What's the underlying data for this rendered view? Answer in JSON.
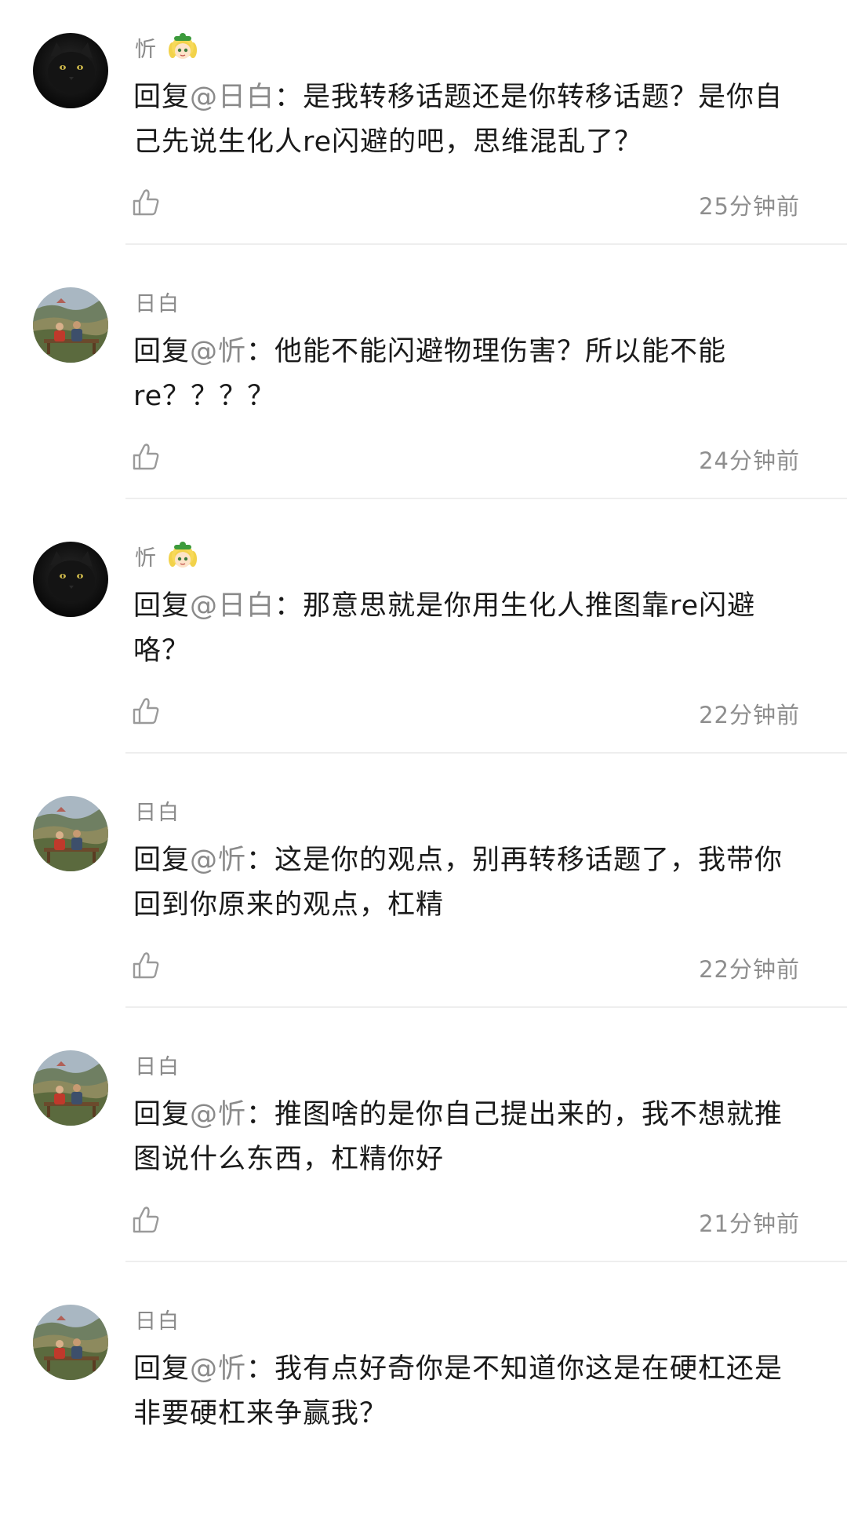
{
  "comments": [
    {
      "username": "忻",
      "has_badge": true,
      "avatar": "black-cat-avatar",
      "reply_prefix": "回复",
      "mention": "@日白",
      "text": "：是我转移话题还是你转移话题？是你自己先说生化人re闪避的吧，思维混乱了？",
      "time": "25分钟前"
    },
    {
      "username": "日白",
      "has_badge": false,
      "avatar": "landscape-couple-avatar",
      "reply_prefix": "回复",
      "mention": "@忻",
      "text": "：他能不能闪避物理伤害？所以能不能re？？？？",
      "time": "24分钟前"
    },
    {
      "username": "忻",
      "has_badge": true,
      "avatar": "black-cat-avatar",
      "reply_prefix": "回复",
      "mention": "@日白",
      "text": "：那意思就是你用生化人推图靠re闪避咯？",
      "time": "22分钟前"
    },
    {
      "username": "日白",
      "has_badge": false,
      "avatar": "landscape-couple-avatar",
      "reply_prefix": "回复",
      "mention": "@忻",
      "text": "：这是你的观点，别再转移话题了，我带你回到你原来的观点，杠精",
      "time": "22分钟前"
    },
    {
      "username": "日白",
      "has_badge": false,
      "avatar": "landscape-couple-avatar",
      "reply_prefix": "回复",
      "mention": "@忻",
      "text": "：推图啥的是你自己提出来的，我不想就推图说什么东西，杠精你好",
      "time": "21分钟前"
    },
    {
      "username": "日白",
      "has_badge": false,
      "avatar": "landscape-couple-avatar",
      "reply_prefix": "回复",
      "mention": "@忻",
      "text": "：我有点好奇你是不知道你这是在硬杠还是非要硬杠来争赢我？",
      "time": ""
    }
  ],
  "icons": {
    "like": "thumbs-up-icon",
    "badge": "anime-girl-badge-icon"
  },
  "colors": {
    "mention": "#8a8a8a",
    "text": "#1a1a1a",
    "meta": "#8e8e8e",
    "divider": "#eeeeee"
  }
}
